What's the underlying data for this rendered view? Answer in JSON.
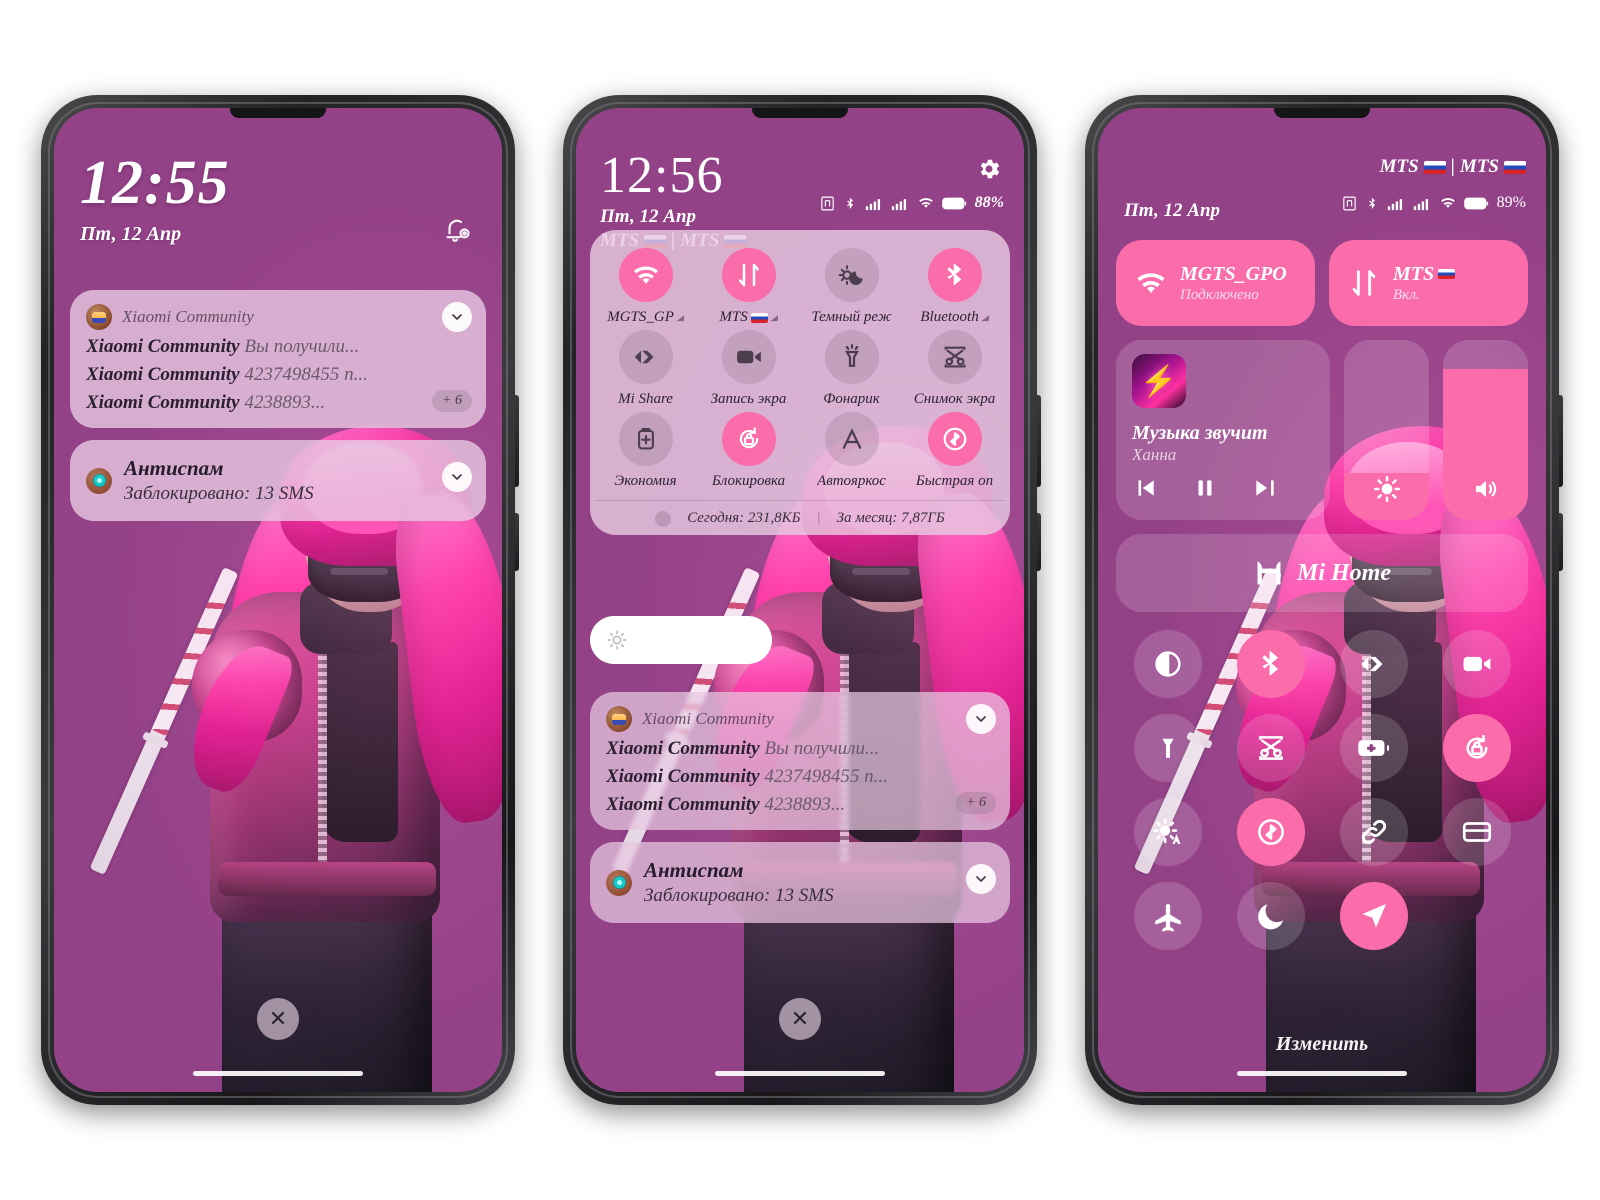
{
  "accent_pink": "#fb6cab",
  "background_purple": "#944288",
  "card_lilac": "#e7c9e2",
  "lock": {
    "clock": "12:55",
    "date": "Пт, 12 Апр",
    "bell_icon": "bell-settings-icon",
    "notifications": [
      {
        "app": "Xiaomi Community",
        "icon": "xiaomi-community-icon",
        "lines": [
          {
            "title": "Xiaomi Community",
            "text": "Вы получили..."
          },
          {
            "title": "Xiaomi Community",
            "text": "4237498455 n..."
          },
          {
            "title": "Xiaomi Community",
            "text": "4238893..."
          }
        ],
        "more_badge": "+ 6"
      },
      {
        "app": "Антиспам",
        "icon": "antispam-icon",
        "title": "Антиспам",
        "subtitle": "Заблокировано: 13 SMS"
      }
    ],
    "close_label": "✕"
  },
  "shade": {
    "clock": "12:56",
    "date": "Пт, 12 Апр",
    "operators": "MTS | MTS",
    "operator_1": "MTS",
    "operator_2": "MTS",
    "battery": "88%",
    "gear_icon": "gear-icon",
    "status_icons": [
      "nfc-icon",
      "bluetooth-icon",
      "signal-icon",
      "signal-icon",
      "wifi-icon",
      "battery-icon"
    ],
    "tiles": [
      {
        "label": "MGTS_GP",
        "icon": "wifi-icon",
        "on": true,
        "caret": true
      },
      {
        "label": "MTS",
        "icon": "mobile-data-icon",
        "on": true,
        "caret": true,
        "flag": true
      },
      {
        "label": "Темный реж",
        "icon": "dark-mode-icon",
        "on": false,
        "caret": false
      },
      {
        "label": "Bluetooth",
        "icon": "bluetooth-icon",
        "on": true,
        "caret": true
      },
      {
        "label": "Mi Share",
        "icon": "mi-share-icon",
        "on": false,
        "caret": false
      },
      {
        "label": "Запись экра",
        "icon": "screen-record-icon",
        "on": false,
        "caret": false
      },
      {
        "label": "Фонарик",
        "icon": "flashlight-icon",
        "on": false,
        "caret": false
      },
      {
        "label": "Снимок экра",
        "icon": "screenshot-icon",
        "on": false,
        "caret": false
      },
      {
        "label": "Экономия",
        "icon": "battery-saver-icon",
        "on": false,
        "caret": false
      },
      {
        "label": "Блокировка",
        "icon": "rotation-lock-icon",
        "on": true,
        "caret": false
      },
      {
        "label": "Автояркос",
        "icon": "auto-brightness-icon",
        "on": false,
        "caret": false
      },
      {
        "label": "Быстрая оп",
        "icon": "quick-pay-icon",
        "on": true,
        "caret": false
      }
    ],
    "data_today_label": "Сегодня: 231,8КБ",
    "data_month_label": "За месяц: 7,87ГБ",
    "brightness_icon": "brightness-icon",
    "notifications": [
      {
        "app": "Xiaomi Community",
        "icon": "xiaomi-community-icon",
        "lines": [
          {
            "title": "Xiaomi Community",
            "text": "Вы получили..."
          },
          {
            "title": "Xiaomi Community",
            "text": "4237498455 n..."
          },
          {
            "title": "Xiaomi Community",
            "text": "4238893..."
          }
        ],
        "more_badge": "+ 6"
      },
      {
        "app": "Антиспам",
        "icon": "antispam-icon",
        "title": "Антиспам",
        "subtitle": "Заблокировано: 13 SMS"
      }
    ],
    "close_label": "✕"
  },
  "control": {
    "date": "Пт, 12 Апр",
    "operators": "MTS | MTS",
    "operator_1": "MTS",
    "operator_2": "MTS",
    "battery": "89%",
    "wifi_tile": {
      "title": "MGTS_GPO",
      "subtitle": "Подключено",
      "icon": "wifi-icon"
    },
    "data_tile": {
      "title": "MTS",
      "subtitle": "Вкл.",
      "icon": "mobile-data-icon"
    },
    "media": {
      "title": "Музыка звучит",
      "artist": "Ханна",
      "album_icon": "album-art",
      "prev_icon": "previous-icon",
      "pause_icon": "pause-icon",
      "next_icon": "next-icon"
    },
    "brightness_slider": {
      "icon": "brightness-icon",
      "level": 26
    },
    "volume_slider": {
      "icon": "volume-icon",
      "level": 84
    },
    "mi_home": {
      "label": "Mi Home",
      "icon": "mi-home-icon"
    },
    "tiles": [
      {
        "icon": "dark-mode-contrast-icon",
        "on": false
      },
      {
        "icon": "bluetooth-icon",
        "on": true
      },
      {
        "icon": "mi-share-icon",
        "on": false
      },
      {
        "icon": "screen-record-icon",
        "on": false
      },
      {
        "icon": "flashlight-icon",
        "on": false
      },
      {
        "icon": "screenshot-icon",
        "on": false
      },
      {
        "icon": "battery-saver-icon",
        "on": false
      },
      {
        "icon": "rotation-lock-icon",
        "on": true
      },
      {
        "icon": "auto-brightness-icon",
        "on": false
      },
      {
        "icon": "quick-pay-icon",
        "on": true
      },
      {
        "icon": "cast-link-icon",
        "on": false
      },
      {
        "icon": "wallet-icon",
        "on": false
      },
      {
        "icon": "airplane-mode-icon",
        "on": false
      },
      {
        "icon": "do-not-disturb-icon",
        "on": false
      },
      {
        "icon": "location-icon",
        "on": true
      }
    ],
    "edit_label": "Изменить"
  }
}
